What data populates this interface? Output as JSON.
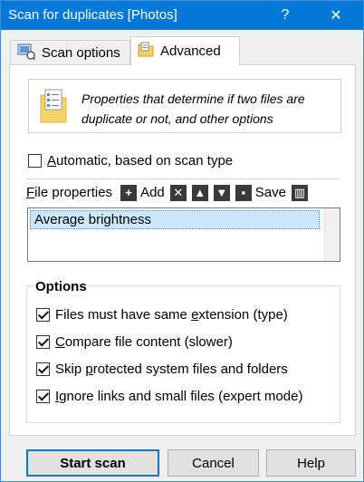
{
  "window": {
    "title": "Scan for duplicates [Photos]",
    "help_glyph": "?",
    "close_glyph": "✕"
  },
  "tabs": [
    {
      "label": "Scan options",
      "icon": "scan-options-icon",
      "selected": false
    },
    {
      "label": "Advanced",
      "icon": "folder-settings-icon",
      "selected": true
    }
  ],
  "info": {
    "icon": "document-list-icon",
    "text": "Properties that determine if two files are duplicate or not, and other options"
  },
  "automatic": {
    "label_prefix": "A",
    "label_rest": "utomatic, based on scan type",
    "checked": false
  },
  "toolbar": {
    "label_prefix": "F",
    "label_rest": "ile properties",
    "add_label": "Add",
    "save_label": "Save",
    "add_glyph": "+",
    "remove_glyph": "✕",
    "up_glyph": "▲",
    "down_glyph": "▼",
    "save_glyph": "▪",
    "delete_glyph": "▥"
  },
  "file_properties": {
    "items": [
      "Average brightness"
    ]
  },
  "options": {
    "legend": "Options",
    "items": [
      {
        "before": "Files must have same ",
        "key": "e",
        "after": "xtension (type)",
        "checked": true
      },
      {
        "before": "",
        "key": "C",
        "after": "ompare file content (slower)",
        "checked": true
      },
      {
        "before": "Skip ",
        "key": "p",
        "after": "rotected system files and folders",
        "checked": true
      },
      {
        "before": "",
        "key": "I",
        "after": "gnore links and small files (expert mode)",
        "checked": true
      }
    ]
  },
  "buttons": {
    "start": "Start scan",
    "cancel": "Cancel",
    "help": "Help"
  },
  "colors": {
    "title_bar": "#0078d7",
    "selection": "#cce8ff",
    "default_button_border": "#0078d7"
  }
}
